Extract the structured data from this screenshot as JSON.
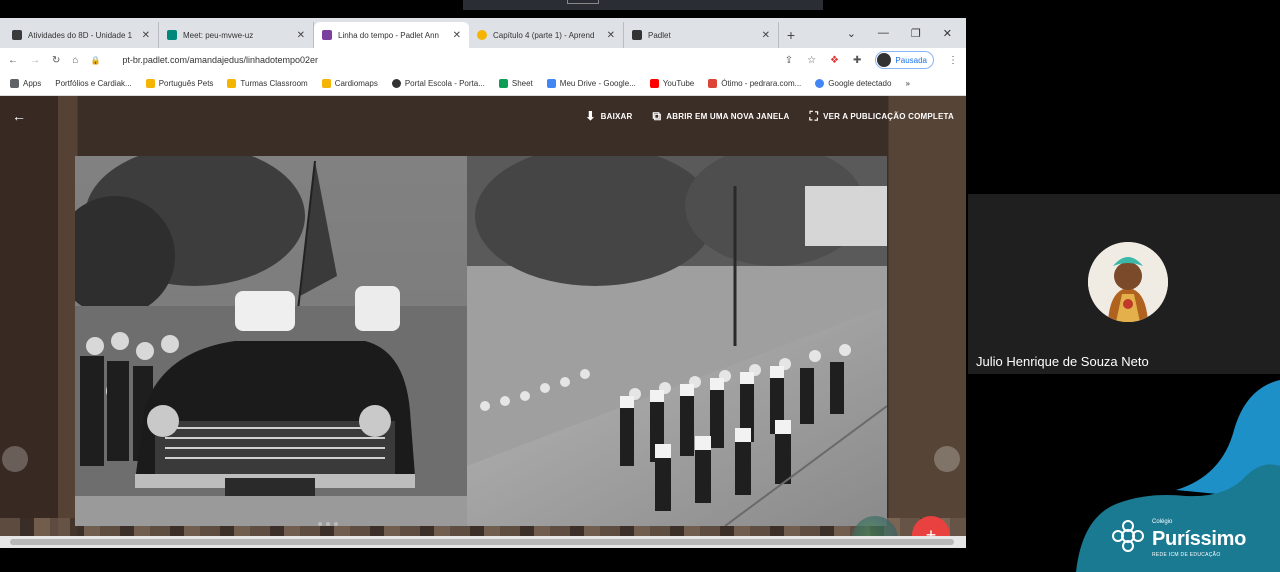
{
  "browser": {
    "tabs": [
      {
        "label": "Atividades do 8D - Unidade 1",
        "favicon_color": "#3b3b3b"
      },
      {
        "label": "Meet: peu-mvwe-uz",
        "favicon_color": "#00897b"
      },
      {
        "label": "Linha do tempo - Padlet Ann",
        "favicon_color": "#7b3fa0",
        "active": true
      },
      {
        "label": "Capítulo 4 (parte 1) - Aprend",
        "favicon_color": "#f4b400"
      },
      {
        "label": "Padlet",
        "favicon_color": "#333333"
      }
    ],
    "new_tab_symbol": "+",
    "window_controls": [
      "⌄",
      "—",
      "❐",
      "✕"
    ],
    "url": "pt-br.padlet.com/amandajedus/linhadotempo02er",
    "profile_label": "Pausada",
    "bookmarks": [
      {
        "label": "Apps",
        "color": "#5f6368"
      },
      {
        "label": "Portfólios e Cardiak...",
        "color": "#f4b400"
      },
      {
        "label": "Português Pets",
        "color": "#f4b400"
      },
      {
        "label": "Turmas Classroom",
        "color": "#f4b400"
      },
      {
        "label": "Cardiomaps",
        "color": "#f4b400"
      },
      {
        "label": "Portal Escola - Porta...",
        "color": "#333333"
      },
      {
        "label": "Sheet",
        "color": "#0f9d58"
      },
      {
        "label": "Meu Drive - Google...",
        "color": "#4285f4"
      },
      {
        "label": "YouTube",
        "color": "#ff0000"
      },
      {
        "label": "Ótimo - pedrara.com...",
        "color": "#db4437"
      },
      {
        "label": "Google detectado",
        "color": "#4285f4"
      }
    ]
  },
  "padlet": {
    "back_icon": "arrow-left-icon",
    "actions": [
      {
        "label": "BAIXAR",
        "icon": "download-icon"
      },
      {
        "label": "ABRIR EM UMA NOVA JANELA",
        "icon": "open-new-window-icon"
      },
      {
        "label": "VER A PUBLICAÇÃO COMPLETA",
        "icon": "fullscreen-icon"
      }
    ],
    "fab_symbol": "+"
  },
  "participant": {
    "name": "Julio Henrique de Souza Neto"
  },
  "brand": {
    "small": "Colégio",
    "name": "Puríssimo",
    "tagline": "REDE ICM DE EDUCAÇÃO",
    "colors": {
      "teal": "#1a7a92",
      "blue": "#1e90c8"
    }
  }
}
